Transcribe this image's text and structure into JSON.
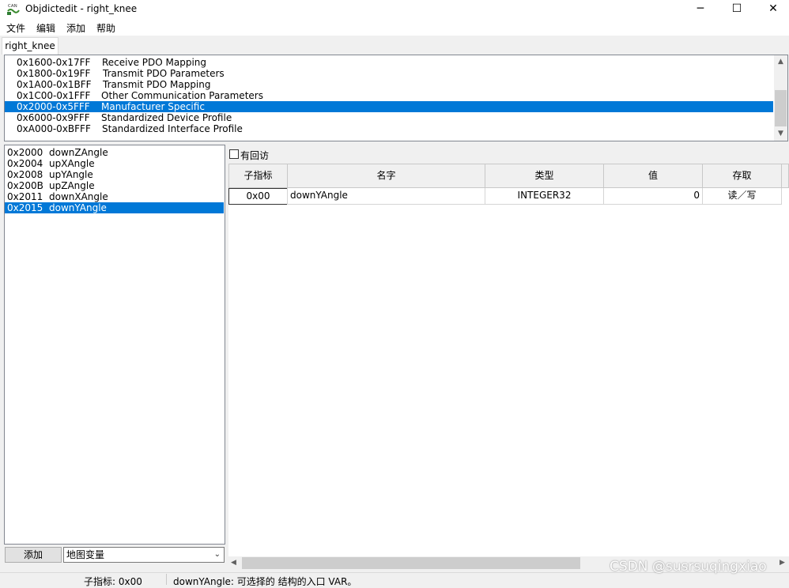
{
  "window": {
    "title": "Objdictedit - right_knee",
    "icon_label": "CAN",
    "controls": {
      "minimize": "─",
      "maximize": "☐",
      "close": "✕"
    }
  },
  "menu": [
    "文件",
    "编辑",
    "添加",
    "帮助"
  ],
  "tab": {
    "label": "right_knee"
  },
  "sections": [
    {
      "range": "0x1600-0x17FF",
      "name": "Receive PDO Mapping"
    },
    {
      "range": "0x1800-0x19FF",
      "name": "Transmit PDO Parameters"
    },
    {
      "range": "0x1A00-0x1BFF",
      "name": "Transmit PDO Mapping"
    },
    {
      "range": "0x1C00-0x1FFF",
      "name": "Other Communication Parameters"
    },
    {
      "range": "0x2000-0x5FFF",
      "name": "Manufacturer Specific"
    },
    {
      "range": "0x6000-0x9FFF",
      "name": "Standardized Device Profile"
    },
    {
      "range": "0xA000-0xBFFF",
      "name": "Standardized Interface Profile"
    }
  ],
  "indexes": [
    {
      "index": "0x2000",
      "name": "downZAngle"
    },
    {
      "index": "0x2004",
      "name": "upXAngle"
    },
    {
      "index": "0x2008",
      "name": "upYAngle"
    },
    {
      "index": "0x200B",
      "name": "upZAngle"
    },
    {
      "index": "0x2011",
      "name": "downXAngle"
    },
    {
      "index": "0x2015",
      "name": "downYAngle"
    }
  ],
  "bottom_controls": {
    "add_button": "添加",
    "type_select": "地图变量"
  },
  "callback": {
    "label": "有回访",
    "checked": false
  },
  "grid": {
    "headers": [
      "子指标",
      "名字",
      "类型",
      "值",
      "存取"
    ],
    "rows": [
      {
        "subindex": "0x00",
        "name": "downYAngle",
        "type": "INTEGER32",
        "value": "0",
        "access": "读／写"
      }
    ]
  },
  "status": {
    "subindex": "子指标:   0x00",
    "message": "downYAngle:   可选择的 结构的入口 VAR。"
  },
  "watermark": "CSDN @susrsuqingxiao",
  "colors": {
    "selection": "#0078d7",
    "window_bg": "#f0f0f0"
  }
}
